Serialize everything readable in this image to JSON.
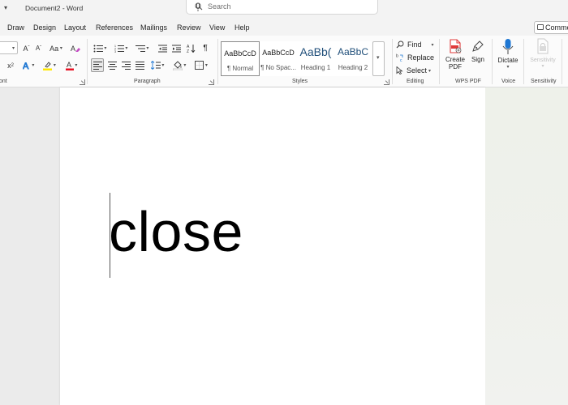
{
  "window": {
    "doc_title": "Document2 - Word",
    "search_placeholder": "Search"
  },
  "menu": {
    "tabs": [
      "Draw",
      "Design",
      "Layout",
      "References",
      "Mailings",
      "Review",
      "View",
      "Help"
    ],
    "comments_label": "Comments"
  },
  "ribbon": {
    "font": {
      "grow_label": "A",
      "shrink_label": "A",
      "case_label": "Aa",
      "superscript_label": "x",
      "group_label": "ont"
    },
    "paragraph": {
      "group_label": "Paragraph"
    },
    "styles": {
      "group_label": "Styles",
      "items": [
        {
          "sample": "AaBbCcD",
          "name": "¶ Normal"
        },
        {
          "sample": "AaBbCcD",
          "name": "¶ No Spac..."
        },
        {
          "sample": "AaBb(",
          "name": "Heading 1"
        },
        {
          "sample": "AaBbC",
          "name": "Heading 2"
        }
      ]
    },
    "editing": {
      "group_label": "Editing",
      "find_label": "Find",
      "replace_label": "Replace",
      "select_label": "Select"
    },
    "wps_pdf": {
      "group_label": "WPS PDF",
      "create_pdf_label": "Create PDF",
      "sign_label": "Sign"
    },
    "voice": {
      "group_label": "Voice",
      "dictate_label": "Dictate"
    },
    "sensitivity": {
      "group_label": "Sensitivity",
      "button_label": "Sensitivity"
    }
  },
  "document": {
    "text": "close"
  },
  "colors": {
    "highlight": "#ffe800",
    "font_color": "#e81123",
    "pdf_red": "#e03a3a",
    "mic_blue": "#1e77d3"
  }
}
